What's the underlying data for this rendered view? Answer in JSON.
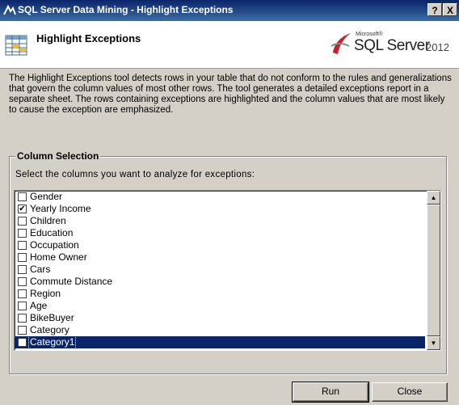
{
  "window": {
    "title": "SQL Server Data Mining - Highlight Exceptions",
    "help_label": "?",
    "close_label": "X"
  },
  "header": {
    "title": "Highlight Exceptions",
    "brand": {
      "microsoft": "Microsoft®",
      "product": "SQL Server",
      "version": "2012"
    }
  },
  "description": "The Highlight Exceptions tool detects rows in your table that do not conform to the rules and generalizations that govern the column values of most other rows. The tool generates a detailed exceptions report in a separate sheet. The rows containing exceptions are highlighted and the column values that are most likely to cause the exception are emphasized.",
  "column_selection": {
    "legend": "Column Selection",
    "prompt": "Select the columns you want to analyze for exceptions:",
    "items": [
      {
        "label": "Gender",
        "checked": false
      },
      {
        "label": "Yearly Income",
        "checked": true
      },
      {
        "label": "Children",
        "checked": false
      },
      {
        "label": "Education",
        "checked": false
      },
      {
        "label": "Occupation",
        "checked": false
      },
      {
        "label": "Home Owner",
        "checked": false
      },
      {
        "label": "Cars",
        "checked": false
      },
      {
        "label": "Commute Distance",
        "checked": false
      },
      {
        "label": "Region",
        "checked": false
      },
      {
        "label": "Age",
        "checked": false
      },
      {
        "label": "BikeBuyer",
        "checked": false
      },
      {
        "label": "Category",
        "checked": false
      },
      {
        "label": "Category1",
        "checked": false,
        "selected": true
      }
    ]
  },
  "buttons": {
    "run": "Run",
    "close": "Close"
  },
  "colors": {
    "titlebar": "#0a246a",
    "selection": "#0a246a",
    "face": "#d4d0c8"
  },
  "icons": {
    "title": "data-mining-icon",
    "tool": "grid-table-icon",
    "brand": "sql-server-logo-icon"
  }
}
